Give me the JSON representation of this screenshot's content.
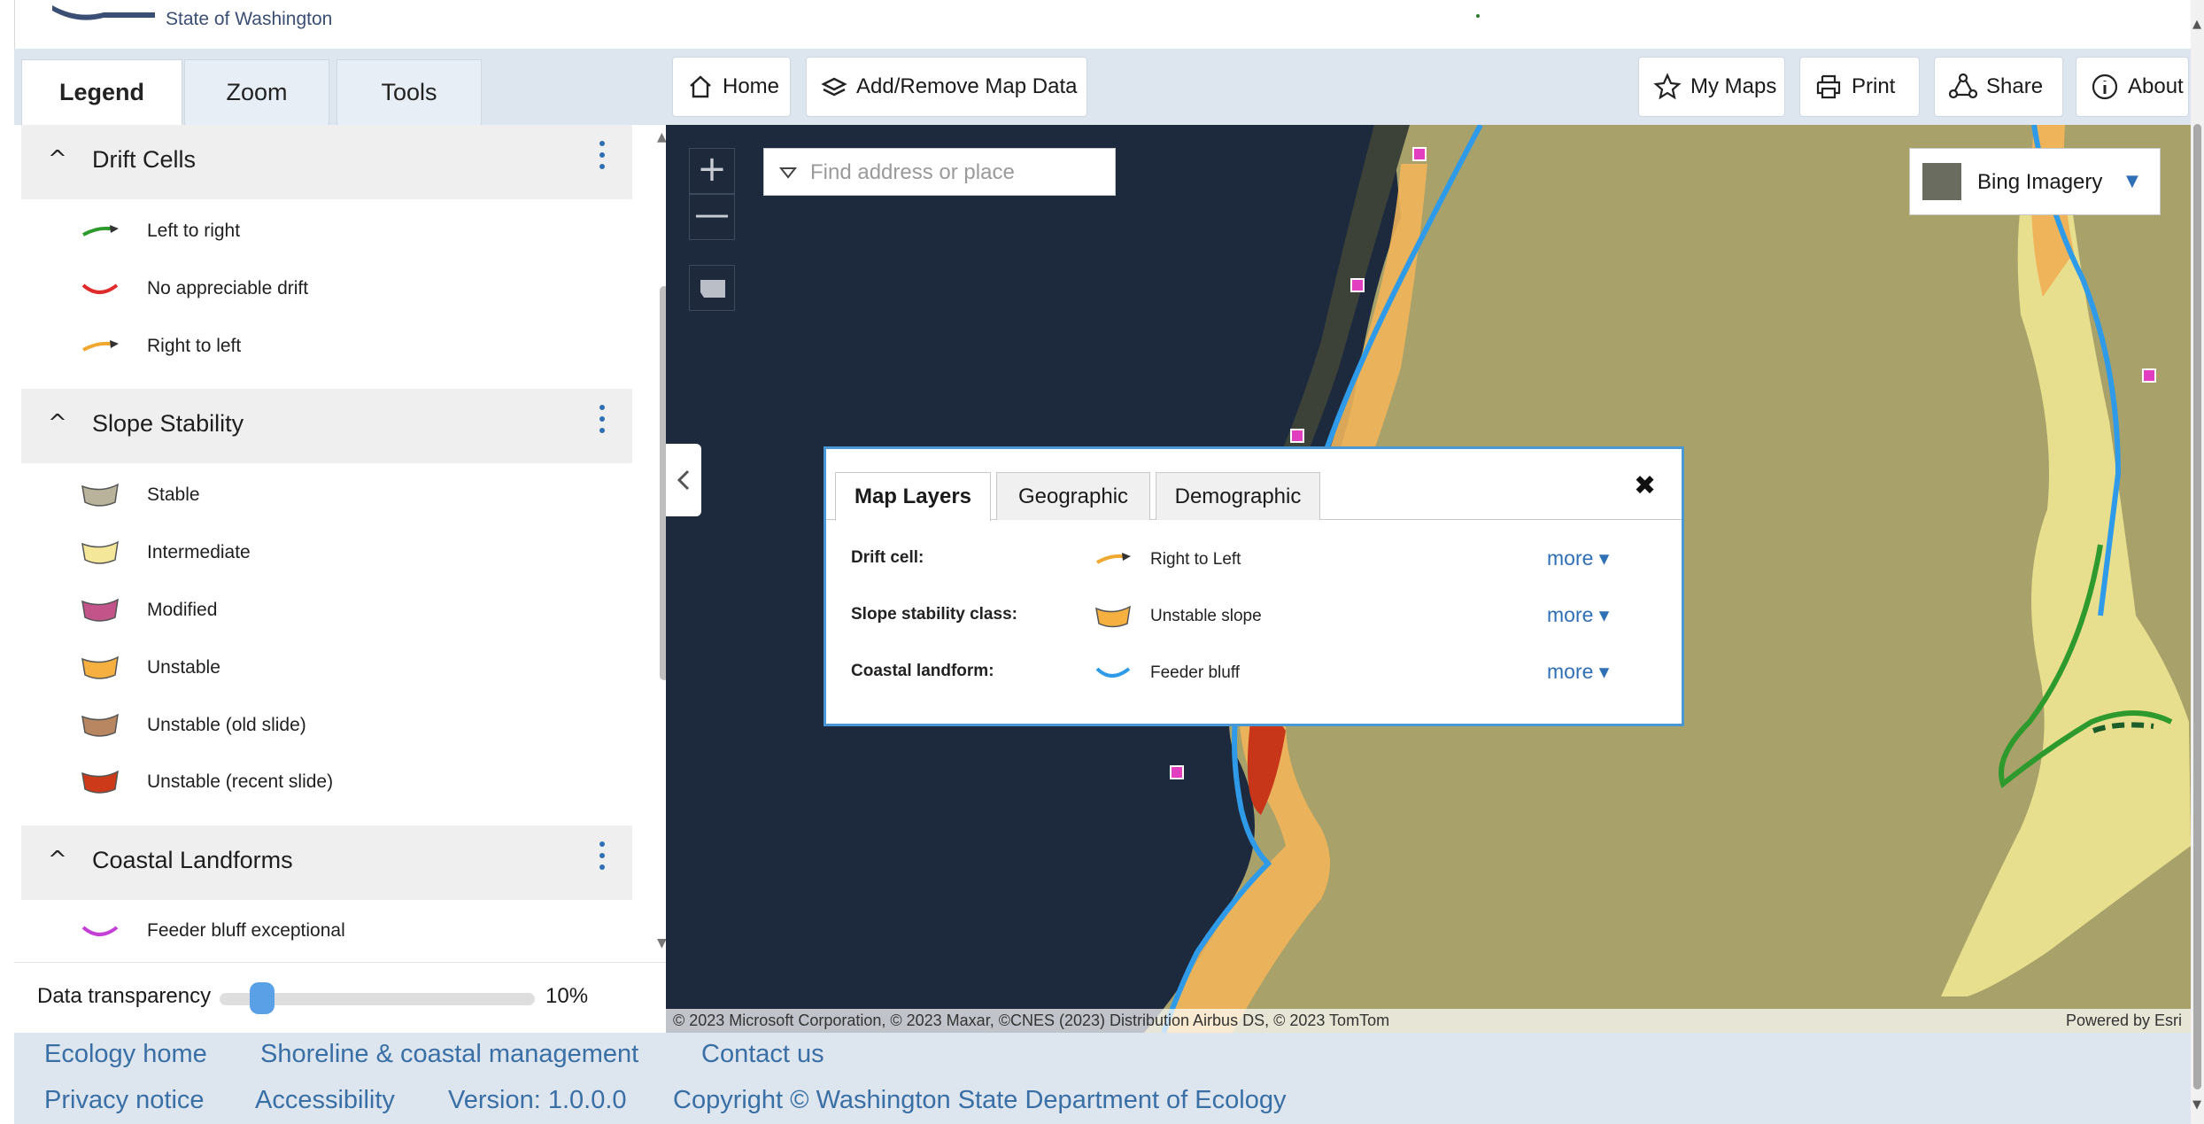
{
  "header": {
    "agency": "State of Washington"
  },
  "left_panel": {
    "tabs": [
      "Legend",
      "Zoom",
      "Tools"
    ],
    "active_tab": "Legend",
    "groups": [
      {
        "title": "Drift Cells",
        "items": [
          {
            "label": "Left to right",
            "icon": "arrow-line",
            "color": "#2e9a2e"
          },
          {
            "label": "No appreciable drift",
            "icon": "curve-line",
            "color": "#e02b2b"
          },
          {
            "label": "Right to left",
            "icon": "arrow-line",
            "color": "#f0a830"
          }
        ]
      },
      {
        "title": "Slope Stability",
        "items": [
          {
            "label": "Stable",
            "icon": "polygon",
            "color": "#b8b39a"
          },
          {
            "label": "Intermediate",
            "icon": "polygon",
            "color": "#f4e79a"
          },
          {
            "label": "Modified",
            "icon": "polygon",
            "color": "#c2548a"
          },
          {
            "label": "Unstable",
            "icon": "polygon",
            "color": "#f5b040"
          },
          {
            "label": "Unstable (old slide)",
            "icon": "polygon",
            "color": "#b88660"
          },
          {
            "label": "Unstable (recent slide)",
            "icon": "polygon",
            "color": "#cc3a1a"
          }
        ]
      },
      {
        "title": "Coastal Landforms",
        "items": [
          {
            "label": "Feeder bluff exceptional",
            "icon": "curve-line",
            "color": "#c43fd6"
          }
        ]
      }
    ],
    "transparency": {
      "label": "Data transparency",
      "value_text": "10%",
      "value": 10
    }
  },
  "toolbar": {
    "home": "Home",
    "add_remove": "Add/Remove Map Data",
    "my_maps": "My Maps",
    "print": "Print",
    "share": "Share",
    "about": "About"
  },
  "map": {
    "search_placeholder": "Find address or place",
    "basemap": "Bing Imagery",
    "attribution": "© 2023 Microsoft Corporation, © 2023 Maxar, ©CNES (2023) Distribution Airbus DS, © 2023 TomTom",
    "esri_credit": "Powered by Esri"
  },
  "popup": {
    "tabs": [
      "Map Layers",
      "Geographic",
      "Demographic"
    ],
    "active_tab": "Map Layers",
    "rows": [
      {
        "label": "Drift cell:",
        "value": "Right to Left",
        "icon": "arrow-line",
        "color": "#f0a830",
        "more": "more ▾"
      },
      {
        "label": "Slope stability class:",
        "value": "Unstable slope",
        "icon": "polygon",
        "color": "#f5b040",
        "more": "more ▾"
      },
      {
        "label": "Coastal landform:",
        "value": "Feeder bluff",
        "icon": "curve-line",
        "color": "#2f9be8",
        "more": "more ▾"
      }
    ]
  },
  "footer": {
    "links": [
      "Ecology home",
      "Shoreline & coastal management",
      "Contact us"
    ],
    "privacy": "Privacy notice",
    "accessibility": "Accessibility",
    "version": "Version: 1.0.0.0",
    "copyright": "Copyright © Washington State Department of Ecology"
  },
  "colors": {
    "accent": "#2f6fb5",
    "water": "#1d2a3e",
    "land": "#a8a26a",
    "panel_bg": "#dde6ef",
    "feeder_bluff_line": "#2f9be8"
  }
}
